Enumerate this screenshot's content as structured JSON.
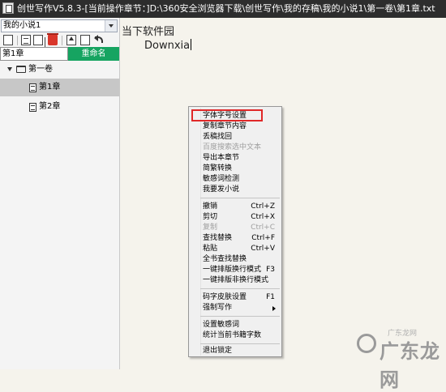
{
  "window": {
    "title": "创世写作V5.8.3-[当前操作章节：]D:\\360安全浏览器下载\\创世写作\\我的存稿\\我的小说1\\第一卷\\第1章.txt"
  },
  "sidebar": {
    "book_select": "我的小说1",
    "chapter_name_value": "第1章",
    "rename_label": "重命名",
    "tree": {
      "volume": "第一卷",
      "chapters": [
        "第1章",
        "第2章"
      ]
    }
  },
  "editor": {
    "line1": "当下软件园",
    "line2": "Downxia"
  },
  "context_menu": {
    "items": [
      {
        "label": "字体字号设置"
      },
      {
        "label": "复制章节内容"
      },
      {
        "label": "丢稿找回"
      },
      {
        "label": "百度搜索选中文本"
      },
      {
        "label": "导出本章节"
      },
      {
        "label": "简繁转换"
      },
      {
        "label": "敏感词检测"
      },
      {
        "label": "我要发小说"
      },
      {
        "label": "撤销",
        "shortcut": "Ctrl+Z"
      },
      {
        "label": "剪切",
        "shortcut": "Ctrl+X"
      },
      {
        "label": "复制",
        "shortcut": "Ctrl+C"
      },
      {
        "label": "查找替换",
        "shortcut": "Ctrl+F"
      },
      {
        "label": "粘贴",
        "shortcut": "Ctrl+V"
      },
      {
        "label": "全书查找替换"
      },
      {
        "label": "一键排版换行模式",
        "shortcut": "F3"
      },
      {
        "label": "一键排版非换行模式"
      },
      {
        "label": "码字皮肤设置",
        "shortcut": "F1"
      },
      {
        "label": "强制写作"
      },
      {
        "label": "设置敏感词"
      },
      {
        "label": "统计当前书籍字数"
      },
      {
        "label": "退出锁定"
      }
    ]
  },
  "watermark": {
    "text": "广东龙网",
    "sub": "广东龙网"
  },
  "colors": {
    "accent_green": "#16a461",
    "highlight_red": "#e02828",
    "titlebar_bg": "#2d2d2d"
  }
}
